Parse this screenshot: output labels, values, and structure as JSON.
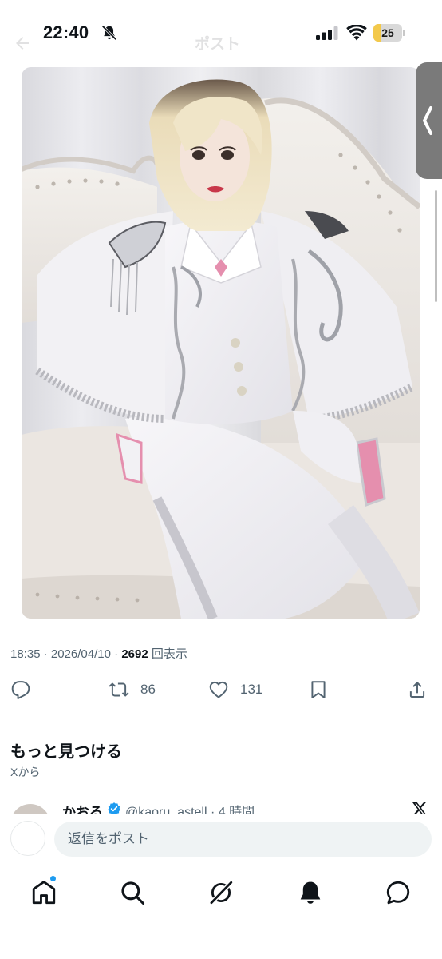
{
  "status_bar": {
    "time": "22:40",
    "battery": "25",
    "battery_level_percent": 25,
    "icons": [
      "bell-slash-icon",
      "cellular-signal-icon",
      "wifi-icon",
      "battery-icon"
    ]
  },
  "header": {
    "title": "ポスト",
    "back_icon": "back-arrow-icon"
  },
  "media": {
    "icon": "photo-image",
    "colors": {
      "background": "#e6e6ea",
      "outfit": "#f4f3f6",
      "silver": "#a9aab0",
      "pink": "#e58fae",
      "hair": "#efe2c2"
    }
  },
  "post": {
    "time": "18:35",
    "date": "2026/04/10",
    "separator": "·",
    "views": "2692",
    "views_label": "回表示"
  },
  "actions": {
    "reply_icon": "reply-icon",
    "repost_icon": "repost-icon",
    "repost_count": "86",
    "like_icon": "heart-icon",
    "like_count": "131",
    "bookmark_icon": "bookmark-icon",
    "share_icon": "share-icon"
  },
  "discover": {
    "title": "もっと見つける",
    "subtitle": "Xから"
  },
  "next_post": {
    "name": "かおる",
    "handle": "@kaoru_astell · 4 時間",
    "verified_icon": "verified-badge-icon",
    "platform_icon": "x-logo-icon"
  },
  "reply": {
    "placeholder": "返信をポスト"
  },
  "tab_bar": {
    "items": [
      "home-icon",
      "search-icon",
      "grok-icon",
      "notifications-icon",
      "messages-icon"
    ]
  },
  "colors": {
    "text_primary": "#0f1419",
    "text_secondary": "#536471",
    "accent": "#1d9bf0",
    "input_bg": "#eff3f4"
  }
}
